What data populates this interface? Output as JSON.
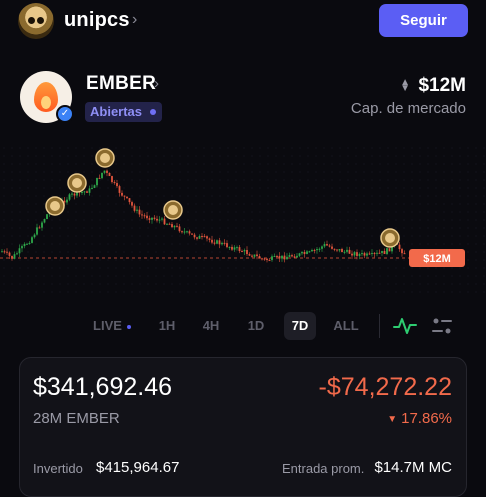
{
  "header": {
    "username": "unipcs",
    "chevron": "›",
    "follow_label": "Seguir"
  },
  "token": {
    "name": "EMBER",
    "chevron": "›",
    "status_badge": "Abiertas",
    "market_cap_value": "$12M",
    "market_cap_label": "Cap. de mercado",
    "logo_icon": "flame-icon",
    "verified_icon": "check-icon"
  },
  "chart": {
    "price_tag": "$12M",
    "colors": {
      "up": "#2ea84b",
      "down": "#e2553d",
      "tag": "#f26a4b"
    },
    "chart_data": {
      "type": "candlestick",
      "current_price": "$12M",
      "markers": 6
    }
  },
  "timeframes": {
    "items": [
      {
        "label": "LIVE"
      },
      {
        "label": "1H"
      },
      {
        "label": "4H"
      },
      {
        "label": "1D"
      },
      {
        "label": "7D"
      },
      {
        "label": "ALL"
      }
    ],
    "active": "7D"
  },
  "position": {
    "balance": "$341,692.46",
    "pnl": "-$74,272.22",
    "holding": "28M EMBER",
    "pnl_pct": "17.86%",
    "invested_label": "Invertido",
    "invested_value": "$415,964.67",
    "entry_label": "Entrada prom.",
    "entry_value": "$14.7M MC"
  },
  "colors": {
    "accent": "#5b5ef4",
    "negative": "#f26a4b",
    "background": "#0a0a0f"
  }
}
